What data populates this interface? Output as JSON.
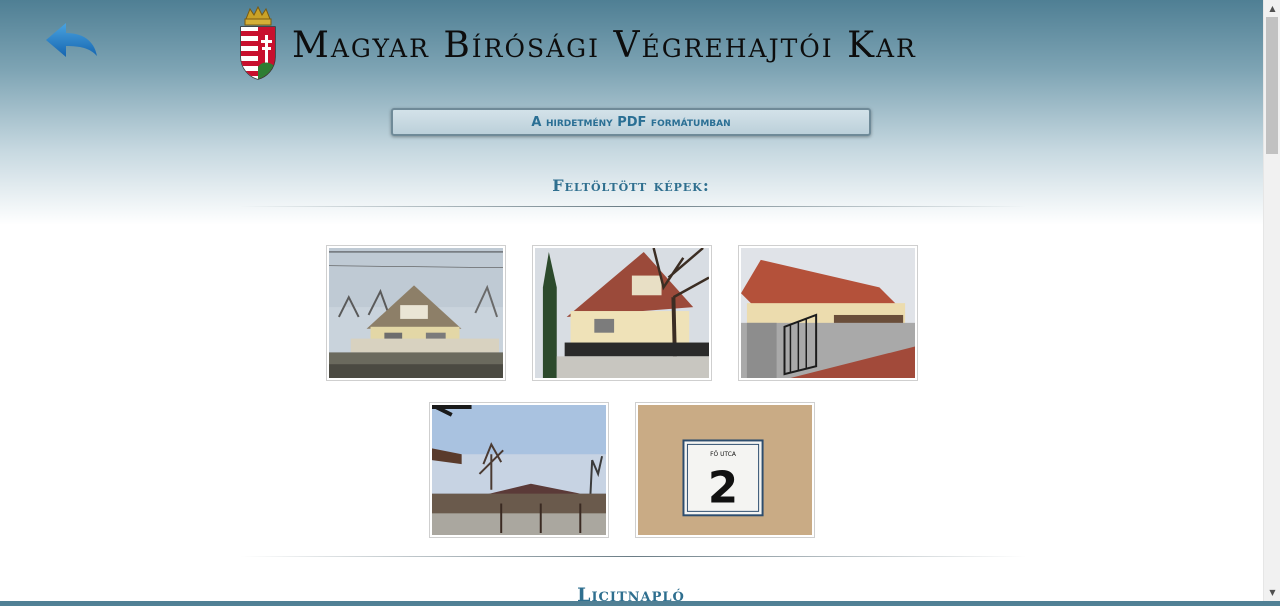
{
  "header": {
    "title": "Magyar Bírósági Végrehajtói Kar",
    "back_icon": "reply-arrow-icon",
    "crest_icon": "hungarian-coat-of-arms-icon"
  },
  "pdf_button": {
    "label": "A hirdetmény PDF formátumban"
  },
  "gallery": {
    "title": "Feltöltött képek:",
    "images": [
      {
        "icon": "house-photo-1"
      },
      {
        "icon": "house-photo-2"
      },
      {
        "icon": "house-photo-3"
      },
      {
        "icon": "park-photo"
      },
      {
        "icon": "house-number-photo"
      }
    ],
    "plate": {
      "street": "FŐ UTCA",
      "number": "2"
    }
  },
  "next_section": {
    "title": "Licitnapló"
  },
  "colors": {
    "accent": "#2f6f8f",
    "header_top": "#4f7f94"
  }
}
